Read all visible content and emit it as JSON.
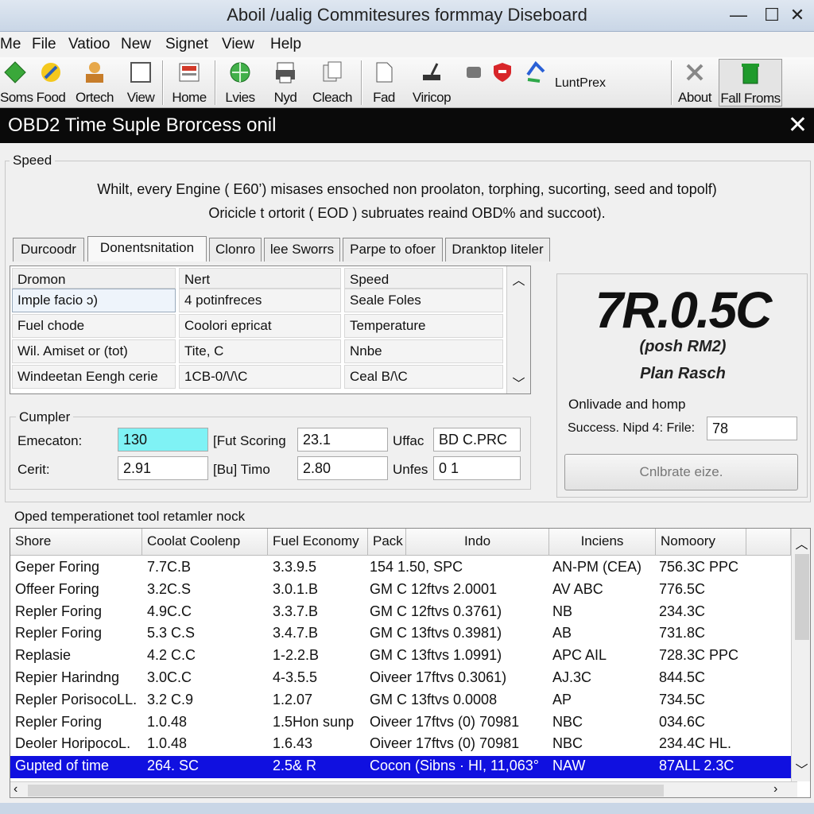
{
  "window": {
    "title": "Aboil /ualig Commitesures formmay Diseboard",
    "min_glyph": "—",
    "max_glyph": "☐",
    "close_glyph": "✕"
  },
  "menu": [
    "Me",
    "File",
    "Vatioo",
    "New",
    "Signet",
    "View",
    "Help"
  ],
  "toolbar": [
    {
      "label": "Soms",
      "icon": "green-diamond-icon"
    },
    {
      "label": "Food",
      "icon": "pencil-icon"
    },
    {
      "label": "Ortech",
      "icon": "user-icon"
    },
    {
      "label": "View",
      "icon": "window-icon"
    },
    {
      "label": "Home",
      "icon": "home-icon"
    },
    {
      "label": "Lvies",
      "icon": "globe-icon"
    },
    {
      "label": "Nyd",
      "icon": "printer-icon"
    },
    {
      "label": "Cleach",
      "icon": "copy-icon"
    },
    {
      "label": "Fad",
      "icon": "document-icon"
    },
    {
      "label": "Viricop",
      "icon": "stamp-icon"
    },
    {
      "label": "",
      "icon": "gear-icon"
    },
    {
      "label": "",
      "icon": "shield-icon"
    },
    {
      "label": "",
      "icon": "arrows-icon"
    },
    {
      "label": "LuntPrex",
      "icon": ""
    },
    {
      "label": "About",
      "icon": "tools-icon"
    },
    {
      "label": "Fall Froms",
      "icon": "trash-icon"
    }
  ],
  "panel": {
    "title": "OBD2 Time Suple Brorcess onil",
    "close_glyph": "✕"
  },
  "speed_group": {
    "label": "Speed",
    "line1": "Whilt, every Engine ( E60’)  misases ensoched non proolaton, torphing, sucorting, seed and topolf)",
    "line2": "Oricicle t ortorit ( EOD ) subruates reaind OBD% and succoot)."
  },
  "tabs": [
    "Durcoodr",
    "Donentsnitation",
    "Clonro",
    "lee Sworrs",
    "Parpe to ofoer",
    "Dranktop Iiteler"
  ],
  "grid": {
    "headers": [
      "Dromon",
      "Nert",
      "Speed"
    ],
    "rows": [
      [
        "Imple facio ɔ)",
        "4 potinfreces",
        "Seale Foles"
      ],
      [
        "Fuel chode",
        "Coolori epricat",
        "Temperature"
      ],
      [
        "Wil. Amiset or (tot)",
        "Tite, C",
        "Nnbe"
      ],
      [
        "Windeetan Eengh cerie",
        "1CB-0/\\/\\C",
        "Ceal B/\\C"
      ]
    ]
  },
  "readout": {
    "value": "7R.0.5C",
    "line1": "(posh RM2)",
    "line2": "Plan Rasch",
    "section_label": "Onlivade and homp",
    "field_label": "Success. Nipd 4: Frile:",
    "field_value": "78",
    "button_label": "Cnlbrate eize."
  },
  "computer_group": {
    "label": "Cumpler",
    "row1": {
      "label": "Emecaton:",
      "value": "130",
      "label2": "[Fut Scoring",
      "value2": "23.1",
      "label3": "Uffac",
      "value3": "BD C.PRC"
    },
    "row2": {
      "label": "Cerit:",
      "value": "2.91",
      "label2": "[Bu] Timo",
      "value2": "2.80",
      "label3": "Unfes",
      "value3": "0 1"
    }
  },
  "table": {
    "label": "Oped temperationet tool retamler nock",
    "headers": [
      "Shore",
      "Coolat Coolenp",
      "Fuel Economy",
      "Pack",
      "Indo",
      "Inciens",
      "Nomoory"
    ],
    "rows": [
      [
        "Geper Foring",
        "7.7C.B",
        "3.3.9.5",
        "154 1.50, SPC",
        "AN-PM (CEA)",
        "756.3C PPC"
      ],
      [
        "Offeer Foring",
        "3.2C.S",
        "3.0.1.B",
        "GM C 12ftvs  2.0001",
        "AV ABC",
        "776.5C"
      ],
      [
        "Repler Foring",
        "4.9C.C",
        "3.3.7.B",
        "GM C 12ftvs  0.3761)",
        "NB",
        "234.3C"
      ],
      [
        "Repler Foring",
        "5.3 C.S",
        "3.4.7.B",
        "GM C 13ftvs  0.3981)",
        "AB",
        "731.8C"
      ],
      [
        "Replasie",
        "4.2 C.C",
        "1-2.2.B",
        "GM C 13ftvs  1.0991)",
        "APC  AIL",
        "728.3C PPC"
      ],
      [
        "Repier Harindng",
        "3.0C.C",
        "4-3.5.5",
        "Oiveer 17ftvs  0.3061)",
        "AJ.3C",
        "844.5C"
      ],
      [
        "Repler PorisocoLL.",
        "3.2 C.9",
        "1.2.07",
        "GM C 13ftvs  0.0008",
        "AP",
        "734.5C"
      ],
      [
        "Repler Foring",
        "1.0.48",
        "1.5Hon sunp",
        "Oiveer 17ftvs  (0)  70981",
        "NBC",
        "034.6C"
      ],
      [
        "Deoler HoripocoL.",
        "1.0.48",
        "1.6.43",
        "Oiveer 17ftvs  (0)  70981",
        "NBC",
        "234.4C HL."
      ],
      [
        "Gupted of time",
        "264. SC",
        "2.5& R",
        "Cocon (Sibns · HI, 11,063°",
        "NAW",
        "87ALL 2.3C"
      ]
    ],
    "selected_row": 9
  },
  "colors": {
    "selection": "#1010e0",
    "input_highlight": "#7ff2f5",
    "header_black": "#0a0a0a"
  }
}
